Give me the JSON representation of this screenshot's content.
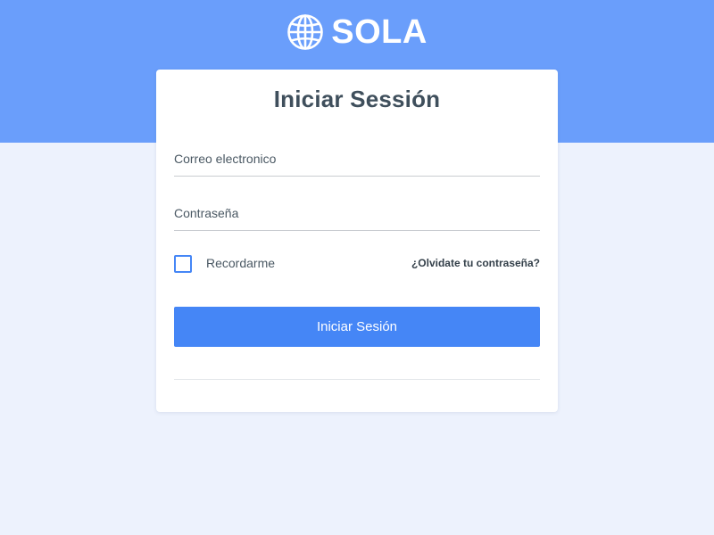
{
  "brand": {
    "name": "SOLA",
    "icon": "globe-icon"
  },
  "login": {
    "title": "Iniciar Sessión",
    "email_placeholder": "Correo electronico",
    "password_placeholder": "Contraseña",
    "remember_label": "Recordarme",
    "remember_checked": false,
    "forgot_link": "¿Olvidate tu contraseña?",
    "submit_label": "Iniciar Sesión"
  },
  "colors": {
    "header_bg": "#6a9efb",
    "page_bg": "#edf2fd",
    "primary": "#4586f6",
    "title_text": "#3f4f5c"
  }
}
